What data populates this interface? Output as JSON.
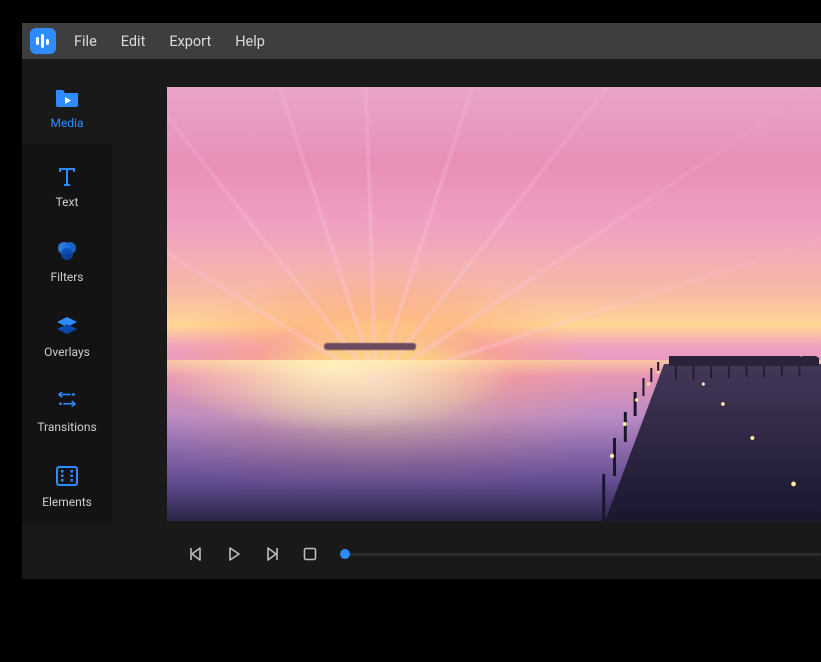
{
  "menubar": {
    "items": [
      {
        "id": "file",
        "label": "File"
      },
      {
        "id": "edit",
        "label": "Edit"
      },
      {
        "id": "export",
        "label": "Export"
      },
      {
        "id": "help",
        "label": "Help"
      }
    ]
  },
  "sidebar": {
    "items": [
      {
        "id": "media",
        "label": "Media",
        "icon": "media-folder-icon",
        "active": true
      },
      {
        "id": "text",
        "label": "Text",
        "icon": "text-icon",
        "active": false
      },
      {
        "id": "filters",
        "label": "Filters",
        "icon": "filters-icon",
        "active": false
      },
      {
        "id": "overlays",
        "label": "Overlays",
        "icon": "overlays-icon",
        "active": false
      },
      {
        "id": "transitions",
        "label": "Transitions",
        "icon": "transitions-icon",
        "active": false
      },
      {
        "id": "elements",
        "label": "Elements",
        "icon": "elements-icon",
        "active": false
      }
    ]
  },
  "player": {
    "controls": {
      "prev_frame": "previous-frame",
      "play": "play",
      "next_frame": "next-frame",
      "stop": "stop"
    },
    "progress_percent": 0
  },
  "colors": {
    "accent": "#2f8cff",
    "menubar_bg": "#3e3e3e",
    "workspace_bg": "#191919",
    "sidebar_dark": "#131313"
  }
}
